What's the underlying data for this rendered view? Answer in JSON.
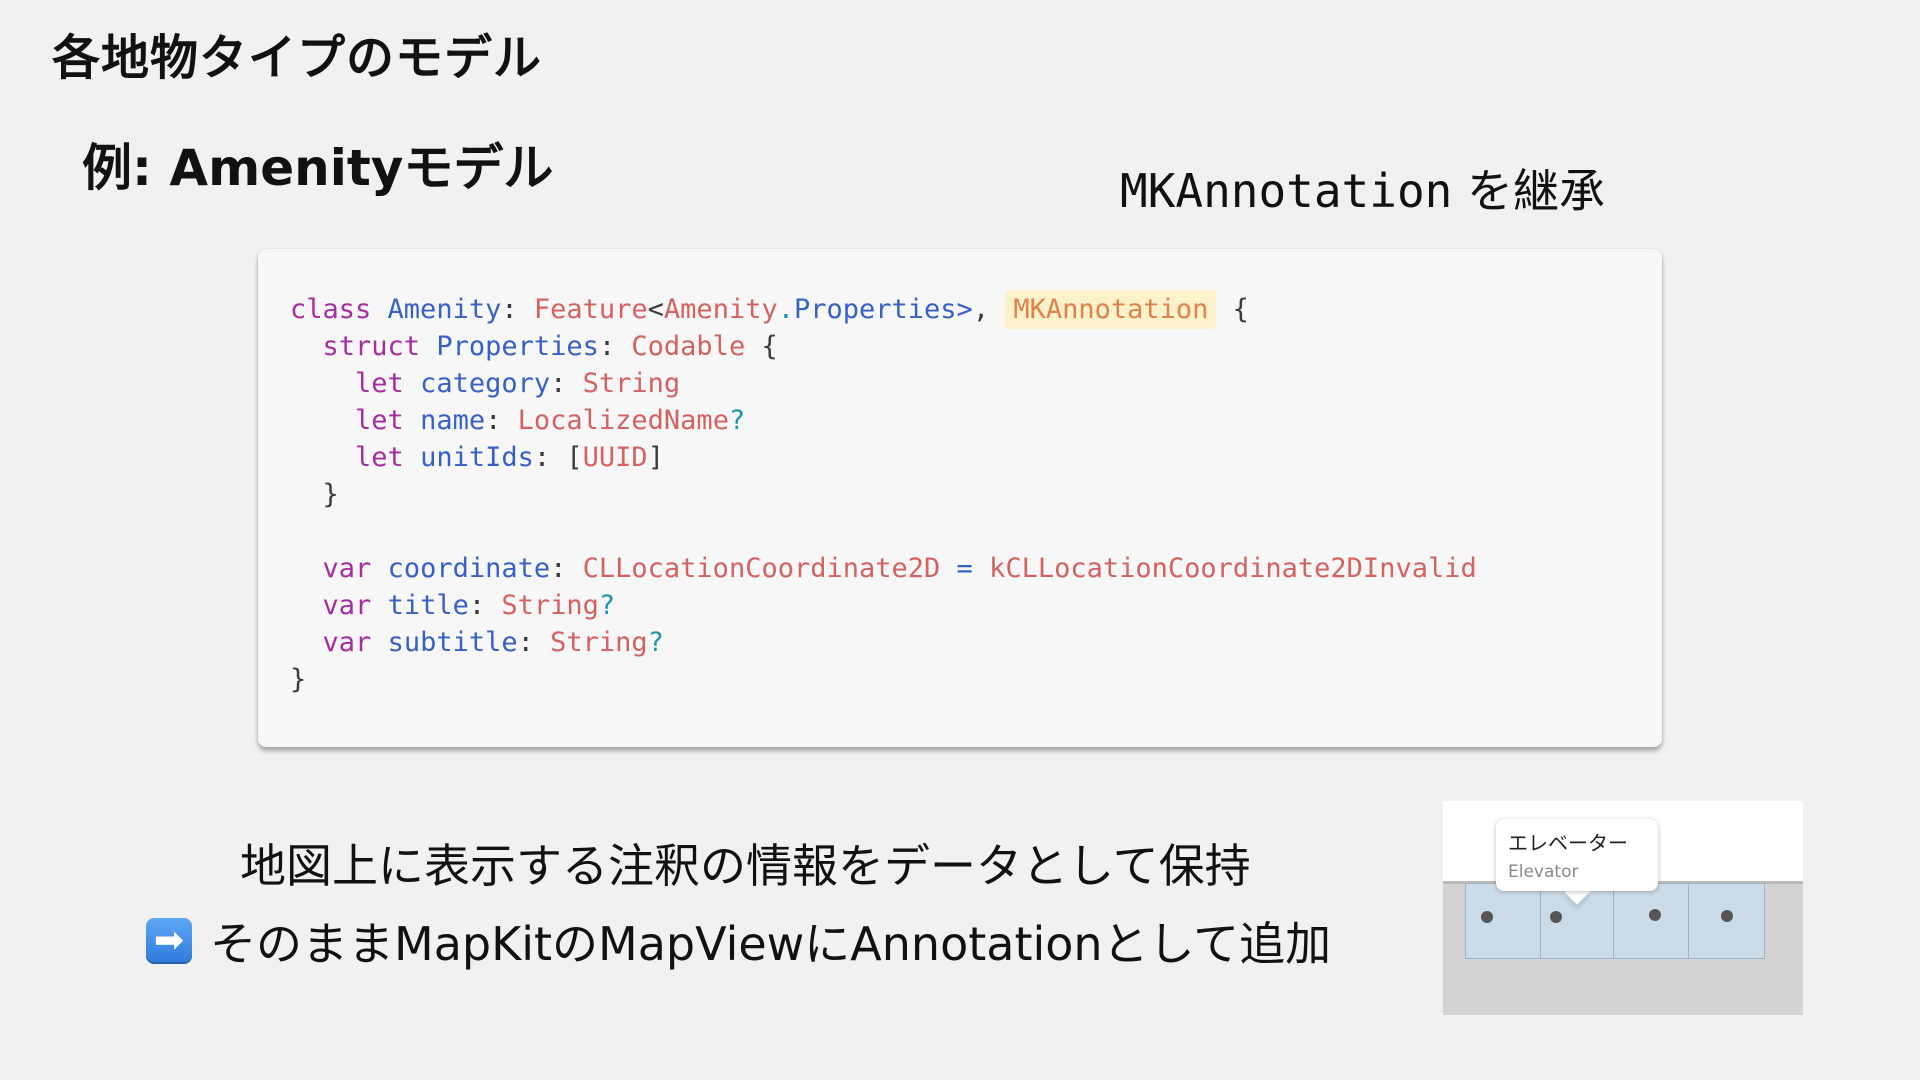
{
  "slide": {
    "title": "各地物タイプのモデル",
    "subtitle": "例: Amenityモデル",
    "inherit_code": "MKAnnotation",
    "inherit_suffix": " を継承"
  },
  "code": {
    "l1_class": "class",
    "l1_name": "Amenity",
    "l1_colon": ": ",
    "l1_feature": "Feature",
    "l1_lt": "<",
    "l1_generic": "Amenity",
    "l1_dot": ".",
    "l1_props": "Properties",
    "l1_gt": ">",
    "l1_comma": ", ",
    "l1_mk": "MKAnnotation",
    "l1_brace": " {",
    "l2_struct": "struct",
    "l2_name": "Properties",
    "l2_colon": ": ",
    "l2_type": "Codable",
    "l2_brace": " {",
    "l3_let": "let",
    "l3_name": "category",
    "l3_colon": ": ",
    "l3_type": "String",
    "l4_let": "let",
    "l4_name": "name",
    "l4_colon": ": ",
    "l4_type": "LocalizedName",
    "l4_opt": "?",
    "l5_let": "let",
    "l5_name": "unitIds",
    "l5_colon": ": [",
    "l5_type": "UUID",
    "l5_close": "]",
    "l6_close": "}",
    "l8_var": "var",
    "l8_name": "coordinate",
    "l8_colon": ": ",
    "l8_type": "CLLocationCoordinate2D",
    "l8_eq": "=",
    "l8_value": "kCLLocationCoordinate2DInvalid",
    "l9_var": "var",
    "l9_name": "title",
    "l9_colon": ": ",
    "l9_type": "String",
    "l9_opt": "?",
    "l10_var": "var",
    "l10_name": "subtitle",
    "l10_colon": ": ",
    "l10_type": "String",
    "l10_opt": "?",
    "l11_close": "}"
  },
  "notes": {
    "line1": "地図上に表示する注釈の情報をデータとして保持",
    "arrow_glyph": "➡",
    "line2": "そのままMapKitのMapViewにAnnotationとして追加"
  },
  "map": {
    "callout_title": "エレベーター",
    "callout_subtitle": "Elevator"
  },
  "colors": {
    "keyword": "#a62ca0",
    "type": "#3761c9",
    "property_type": "#d4625f",
    "highlight_bg": "#fbf2cc",
    "highlight_text": "#e0824a"
  }
}
